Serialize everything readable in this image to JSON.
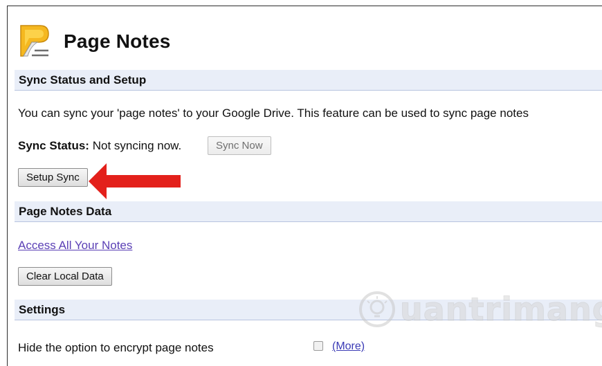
{
  "app": {
    "title": "Page Notes",
    "logo_icon": "page-notes-logo-icon"
  },
  "sections": {
    "sync": {
      "heading": "Sync Status and Setup",
      "description": "You can sync your 'page notes' to your Google Drive. This feature can be used to sync page notes",
      "status_label": "Sync Status:",
      "status_value": "Not syncing now.",
      "sync_now_label": "Sync Now",
      "setup_sync_label": "Setup Sync"
    },
    "data": {
      "heading": "Page Notes Data",
      "access_link": "Access All Your Notes",
      "clear_label": "Clear Local Data"
    },
    "settings": {
      "heading": "Settings",
      "encrypt_option": "Hide the option to encrypt page notes",
      "encrypt_checked": false,
      "more_link": "(More)"
    }
  },
  "annotation": {
    "arrow_color": "#e3201b",
    "points_to": "setup-sync-button"
  },
  "watermark": {
    "text": "uantrimang"
  }
}
